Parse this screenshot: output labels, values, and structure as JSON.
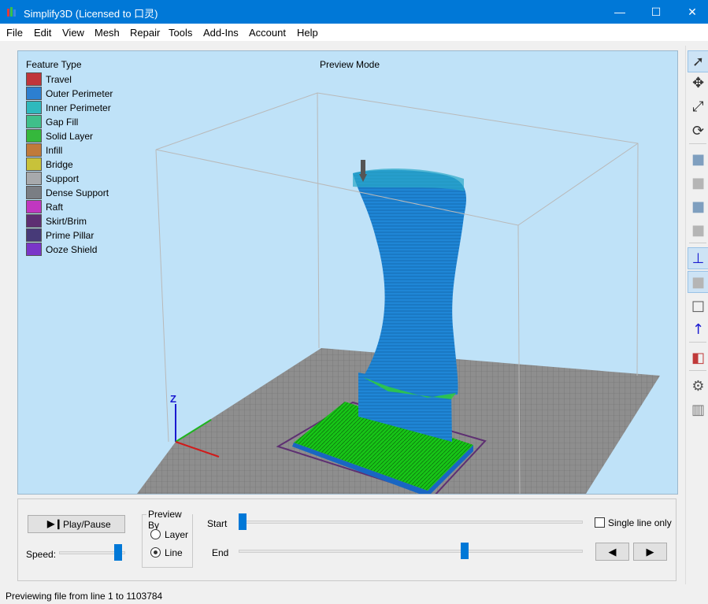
{
  "window": {
    "title": "Simplify3D (Licensed to 口灵)",
    "minimize": "—",
    "maximize": "☐",
    "close": "✕"
  },
  "menu": [
    "File",
    "Edit",
    "View",
    "Mesh",
    "Repair",
    "Tools",
    "Add-Ins",
    "Account",
    "Help"
  ],
  "viewport": {
    "legend_title": "Feature Type",
    "preview_mode": "Preview Mode",
    "axis_z_label": "Z",
    "legend": [
      {
        "label": "Travel",
        "color": "#c0353a"
      },
      {
        "label": "Outer Perimeter",
        "color": "#2c7fd0"
      },
      {
        "label": "Inner Perimeter",
        "color": "#2fb9bd"
      },
      {
        "label": "Gap Fill",
        "color": "#3fbf8a"
      },
      {
        "label": "Solid Layer",
        "color": "#35b83c"
      },
      {
        "label": "Infill",
        "color": "#c07a3a"
      },
      {
        "label": "Bridge",
        "color": "#c8c23a"
      },
      {
        "label": "Support",
        "color": "#a7a9ac"
      },
      {
        "label": "Dense Support",
        "color": "#7a7e84"
      },
      {
        "label": "Raft",
        "color": "#c037c0"
      },
      {
        "label": "Skirt/Brim",
        "color": "#5e2f72"
      },
      {
        "label": "Prime Pillar",
        "color": "#473a78"
      },
      {
        "label": "Ooze Shield",
        "color": "#7a35c8"
      }
    ]
  },
  "toolbar_icons": [
    "select-arrow-icon",
    "move-icon",
    "scale-icon",
    "rotate-icon",
    "view-default-cube-icon",
    "view-front-cube-icon",
    "view-top-cube-icon",
    "view-side-cube-icon",
    "show-axes-icon",
    "solid-view-icon",
    "wireframe-view-icon",
    "normals-icon",
    "cross-section-icon",
    "settings-gear-icon",
    "machine-icon"
  ],
  "panel": {
    "play_pause_label": "Play/Pause",
    "speed_label": "Speed:",
    "speed_level": 0.95,
    "preview_by_title": "Preview By",
    "preview_by_options": [
      {
        "label": "Layer",
        "selected": false
      },
      {
        "label": "Line",
        "selected": true
      }
    ],
    "start_label": "Start",
    "end_label": "End",
    "start_fraction": 0.0,
    "end_fraction": 0.66,
    "single_line_only_label": "Single line only",
    "single_line_only_checked": false,
    "prev_label": "◀",
    "next_label": "▶"
  },
  "status": {
    "text": "Previewing file from line 1 to 1103784"
  }
}
